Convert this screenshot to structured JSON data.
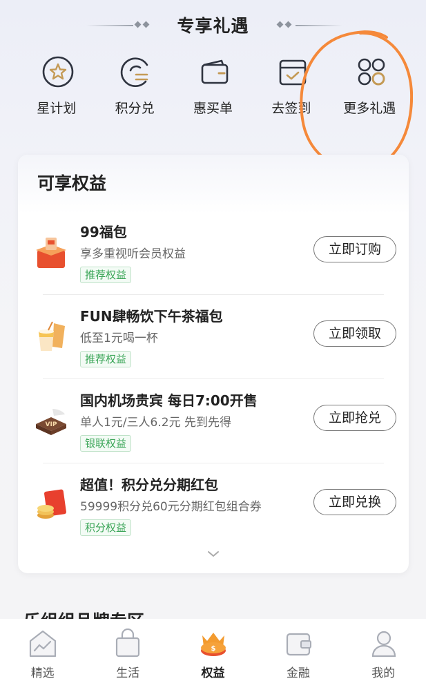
{
  "section_title": "专享礼遇",
  "quick_entries": [
    {
      "label": "星计划",
      "icon": "star-circle-icon"
    },
    {
      "label": "积分兑",
      "icon": "points-exchange-icon"
    },
    {
      "label": "惠买单",
      "icon": "wallet-icon"
    },
    {
      "label": "去签到",
      "icon": "calendar-check-icon"
    },
    {
      "label": "更多礼遇",
      "icon": "more-circles-icon"
    }
  ],
  "card": {
    "title": "可享权益",
    "items": [
      {
        "name": "99福包",
        "desc": "享多重视听会员权益",
        "tag": "推荐权益",
        "button": "立即订购",
        "icon": "red-gift-box-icon"
      },
      {
        "name": "FUN肆畅饮下午茶福包",
        "desc": "低至1元喝一杯",
        "tag": "推荐权益",
        "button": "立即领取",
        "icon": "drink-cup-icon"
      },
      {
        "name": "国内机场贵宾 每日7:00开售",
        "desc": "单人1元/三人6.2元 先到先得",
        "tag": "银联权益",
        "button": "立即抢兑",
        "icon": "vip-airport-icon"
      },
      {
        "name": "超值！积分兑分期红包",
        "desc": "59999积分兑60元分期红包组合券",
        "tag": "积分权益",
        "button": "立即兑换",
        "icon": "red-envelope-coins-icon"
      }
    ]
  },
  "next_section_title": "乐组组品牌专区",
  "tabbar": [
    {
      "label": "精选",
      "icon": "home-chart-icon",
      "active": false
    },
    {
      "label": "生活",
      "icon": "shopping-bag-icon",
      "active": false
    },
    {
      "label": "权益",
      "icon": "crown-coin-icon",
      "active": true
    },
    {
      "label": "金融",
      "icon": "wallet-card-icon",
      "active": false
    },
    {
      "label": "我的",
      "icon": "user-icon",
      "active": false
    }
  ],
  "colors": {
    "gold": "#c49a55",
    "tag_green": "#3aa557",
    "highlight_orange": "#f5893a"
  }
}
